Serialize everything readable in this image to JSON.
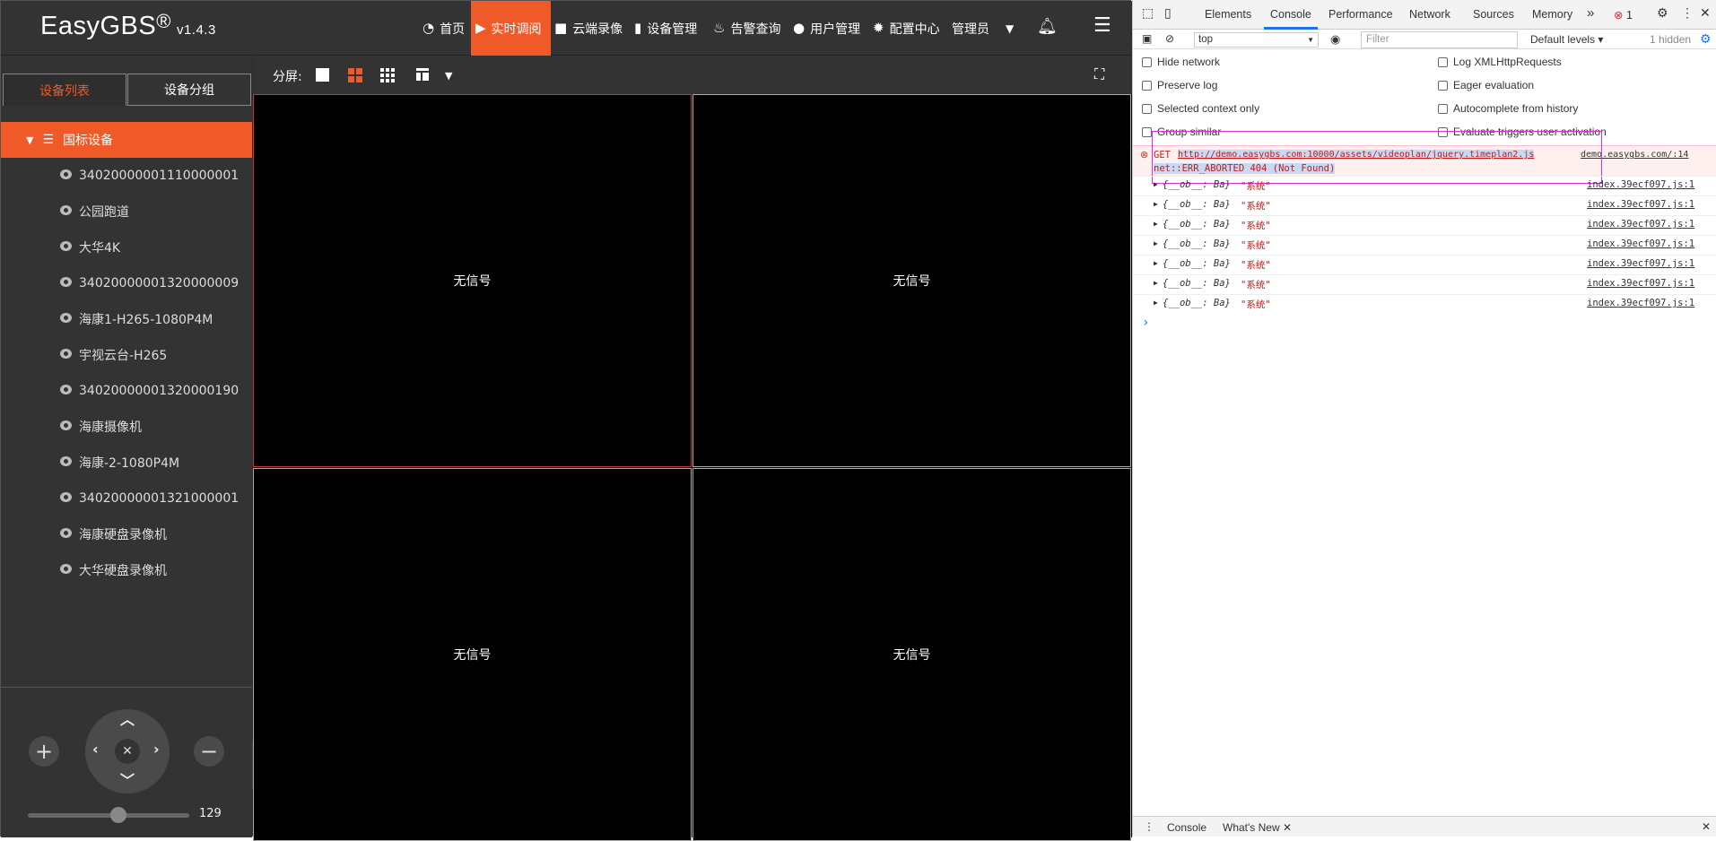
{
  "brand": {
    "name": "EasyGBS",
    "reg": "®",
    "version": "v1.4.3"
  },
  "nav": {
    "items": [
      {
        "label": "首页",
        "icon": "dashboard-icon"
      },
      {
        "label": "实时调阅",
        "icon": "play-icon",
        "active": true
      },
      {
        "label": "云端录像",
        "icon": "video-camera-icon"
      },
      {
        "label": "设备管理",
        "icon": "device-icon"
      },
      {
        "label": "告警查询",
        "icon": "alarm-icon"
      },
      {
        "label": "用户管理",
        "icon": "user-icon"
      },
      {
        "label": "配置中心",
        "icon": "gear-icon"
      }
    ],
    "user": "管理员",
    "accent": "#f05a28"
  },
  "sidebar": {
    "tabs": [
      {
        "label": "设备列表",
        "active": true
      },
      {
        "label": "设备分组"
      }
    ],
    "root": "国标设备",
    "devices": [
      "34020000001110000001",
      "公园跑道",
      "大华4K",
      "34020000001320000009",
      "海康1-H265-1080P4M",
      "宇视云台-H265",
      "34020000001320000190",
      "海康摄像机",
      "海康-2-1080P4M",
      "34020000001321000001",
      "海康硬盘录像机",
      "大华硬盘录像机"
    ]
  },
  "ptz": {
    "speed": 129,
    "speed_fraction": 0.56
  },
  "player": {
    "split_label": "分屏:",
    "cells": [
      "无信号",
      "无信号",
      "无信号",
      "无信号"
    ]
  },
  "devtools": {
    "tabs": [
      "Elements",
      "Console",
      "Performance",
      "Network",
      "Sources",
      "Memory"
    ],
    "more": "»",
    "error_count": "1",
    "context": "top",
    "filter_placeholder": "Filter",
    "levels": "Default levels",
    "hidden": "1 hidden",
    "options_left": [
      "Hide network",
      "Preserve log",
      "Selected context only",
      "Group similar"
    ],
    "options_right": [
      "Log XMLHttpRequests",
      "Eager evaluation",
      "Autocomplete from history",
      "Evaluate triggers user activation"
    ],
    "error": {
      "method": "GET",
      "url": "http://demo.easygbs.com:10000/assets/videoplan/jquery.timeplan2.js",
      "source": "demo.easygbs.com/:14",
      "message": "net::ERR_ABORTED 404 (Not Found)"
    },
    "logs": [
      {
        "text": "{__ob__: Ba}",
        "value": "\"系统\"",
        "source": "index.39ecf097.js:1"
      },
      {
        "text": "{__ob__: Ba}",
        "value": "\"系统\"",
        "source": "index.39ecf097.js:1"
      },
      {
        "text": "{__ob__: Ba}",
        "value": "\"系统\"",
        "source": "index.39ecf097.js:1"
      },
      {
        "text": "{__ob__: Ba}",
        "value": "\"系统\"",
        "source": "index.39ecf097.js:1"
      },
      {
        "text": "{__ob__: Ba}",
        "value": "\"系统\"",
        "source": "index.39ecf097.js:1"
      },
      {
        "text": "{__ob__: Ba}",
        "value": "\"系统\"",
        "source": "index.39ecf097.js:1"
      },
      {
        "text": "{__ob__: Ba}",
        "value": "\"系统\"",
        "source": "index.39ecf097.js:1"
      }
    ],
    "prompt": "›",
    "drawer_tabs": [
      "Console",
      "What's New"
    ]
  }
}
